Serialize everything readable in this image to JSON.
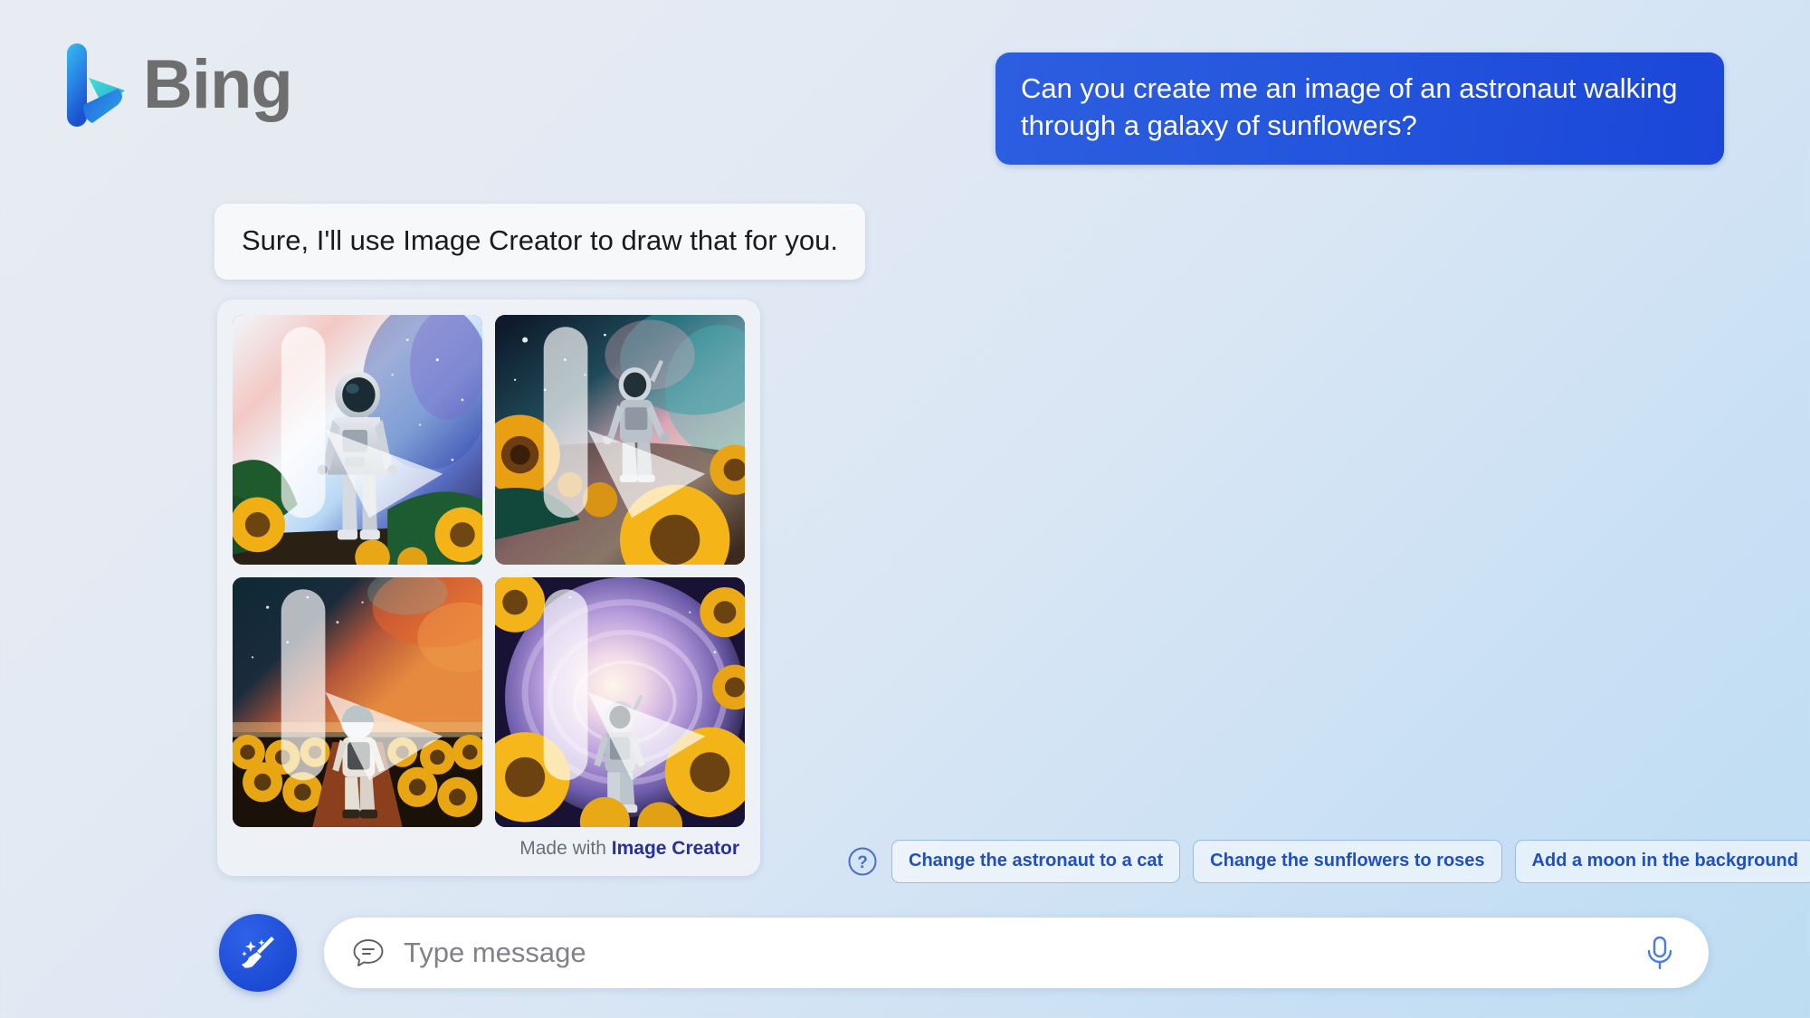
{
  "brand": {
    "name": "Bing",
    "logo_icon": "bing-logo-icon",
    "colors": {
      "gradient_top": "#32b9f0",
      "gradient_bottom": "#1b5fd4",
      "swoosh": "#37d6c8",
      "wordmark": "#6e6e6e"
    }
  },
  "conversation": {
    "user_message": "Can you create me an image of an astronaut walking through a galaxy of sunflowers?",
    "assistant_message": "Sure, I'll use Image Creator to draw that for you.",
    "colors": {
      "user_bubble": "#2456dd",
      "assistant_bubble": "#f7f8fa"
    }
  },
  "results_card": {
    "attribution_prefix": "Made with",
    "attribution_link": "Image Creator",
    "attribution_link_color": "#28309a",
    "images": [
      {
        "alt": "Astronaut standing facing viewer before a bright blue and pink galaxy with sunflowers in the foreground",
        "badge_icon": "bing-badge-icon"
      },
      {
        "alt": "Astronaut walking away into a teal and pink nebula above a field of large sunflowers",
        "badge_icon": "bing-badge-icon"
      },
      {
        "alt": "Astronaut walking down a dirt path through a dense sunflower field under an orange starry sky",
        "badge_icon": "bing-badge-icon"
      },
      {
        "alt": "Astronaut walking toward a glowing purple spiral galaxy framed by yellow sunflowers",
        "badge_icon": "bing-badge-icon"
      }
    ]
  },
  "suggestions": {
    "help_icon": "question-mark-circle-icon",
    "chips": [
      "Change the astronaut to a cat",
      "Change the sunflowers to roses",
      "Add a moon in the background"
    ],
    "chip_text_color": "#204fc4",
    "chip_border_color": "#9cbbe8"
  },
  "composer": {
    "new_topic_icon": "broom-sparkle-icon",
    "chat_icon": "chat-bubble-icon",
    "mic_icon": "microphone-icon",
    "input_value": "",
    "input_placeholder": "Type message",
    "new_topic_color": "#2050d8",
    "mic_color": "#4b7de0"
  }
}
